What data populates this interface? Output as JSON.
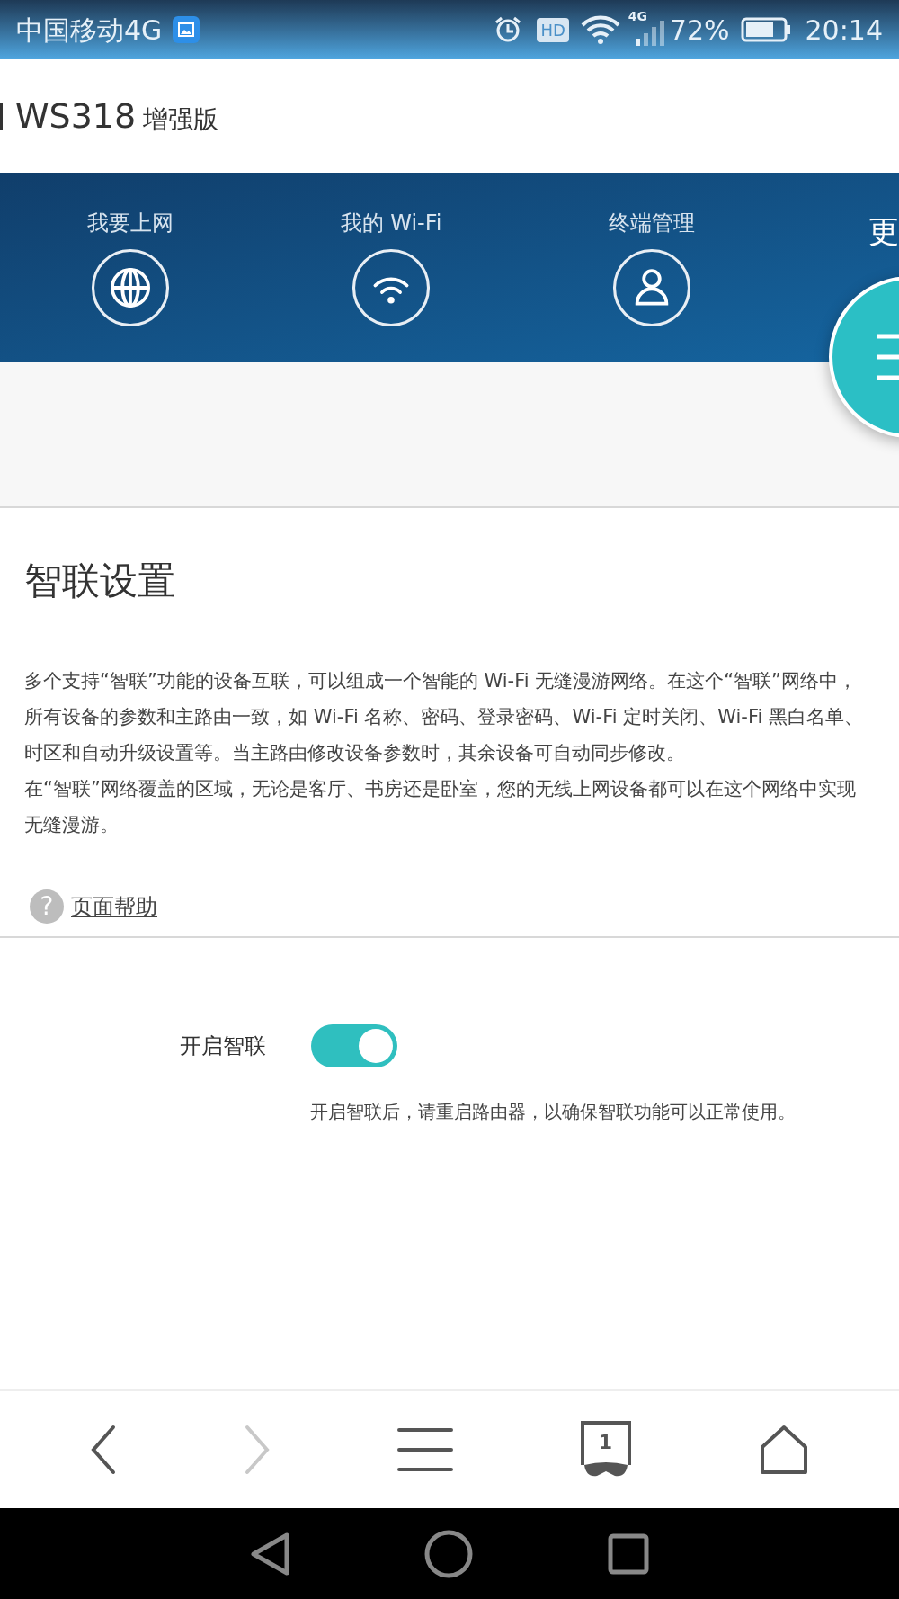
{
  "status_bar": {
    "carrier": "中国移动4G",
    "network": "4G",
    "hd": "HD",
    "battery": "72%",
    "time": "20:14"
  },
  "header": {
    "title": "WS318",
    "subtitle": "增强版"
  },
  "nav": [
    {
      "label": "我要上网"
    },
    {
      "label": "我的 Wi-Fi"
    },
    {
      "label": "终端管理"
    }
  ],
  "more": {
    "label": "更"
  },
  "section": {
    "title": "智联设置",
    "paragraphs": [
      "多个支持“智联”功能的设备互联，可以组成一个智能的 Wi-Fi 无缝漫游网络。在这个“智联”网络中，所有设备的参数和主路由一致，如 Wi-Fi 名称、密码、登录密码、Wi-Fi 定时关闭、Wi-Fi 黑白名单、时区和自动升级设置等。当主路由修改设备参数时，其余设备可自动同步修改。",
      "在“智联”网络覆盖的区域，无论是客厅、书房还是卧室，您的无线上网设备都可以在这个网络中实现无缝漫游。"
    ],
    "help_icon": "?",
    "help": "页面帮助"
  },
  "setting": {
    "label": "开启智联",
    "on": true,
    "hint": "开启智联后，请重启路由器，以确保智联功能可以正常使用。"
  },
  "browser_bar": [
    {
      "kind": "back",
      "disabled": false
    },
    {
      "kind": "forward",
      "disabled": true
    },
    {
      "kind": "menu",
      "disabled": false
    },
    {
      "kind": "tabs",
      "count": "1",
      "disabled": false
    },
    {
      "kind": "home",
      "disabled": false
    }
  ]
}
